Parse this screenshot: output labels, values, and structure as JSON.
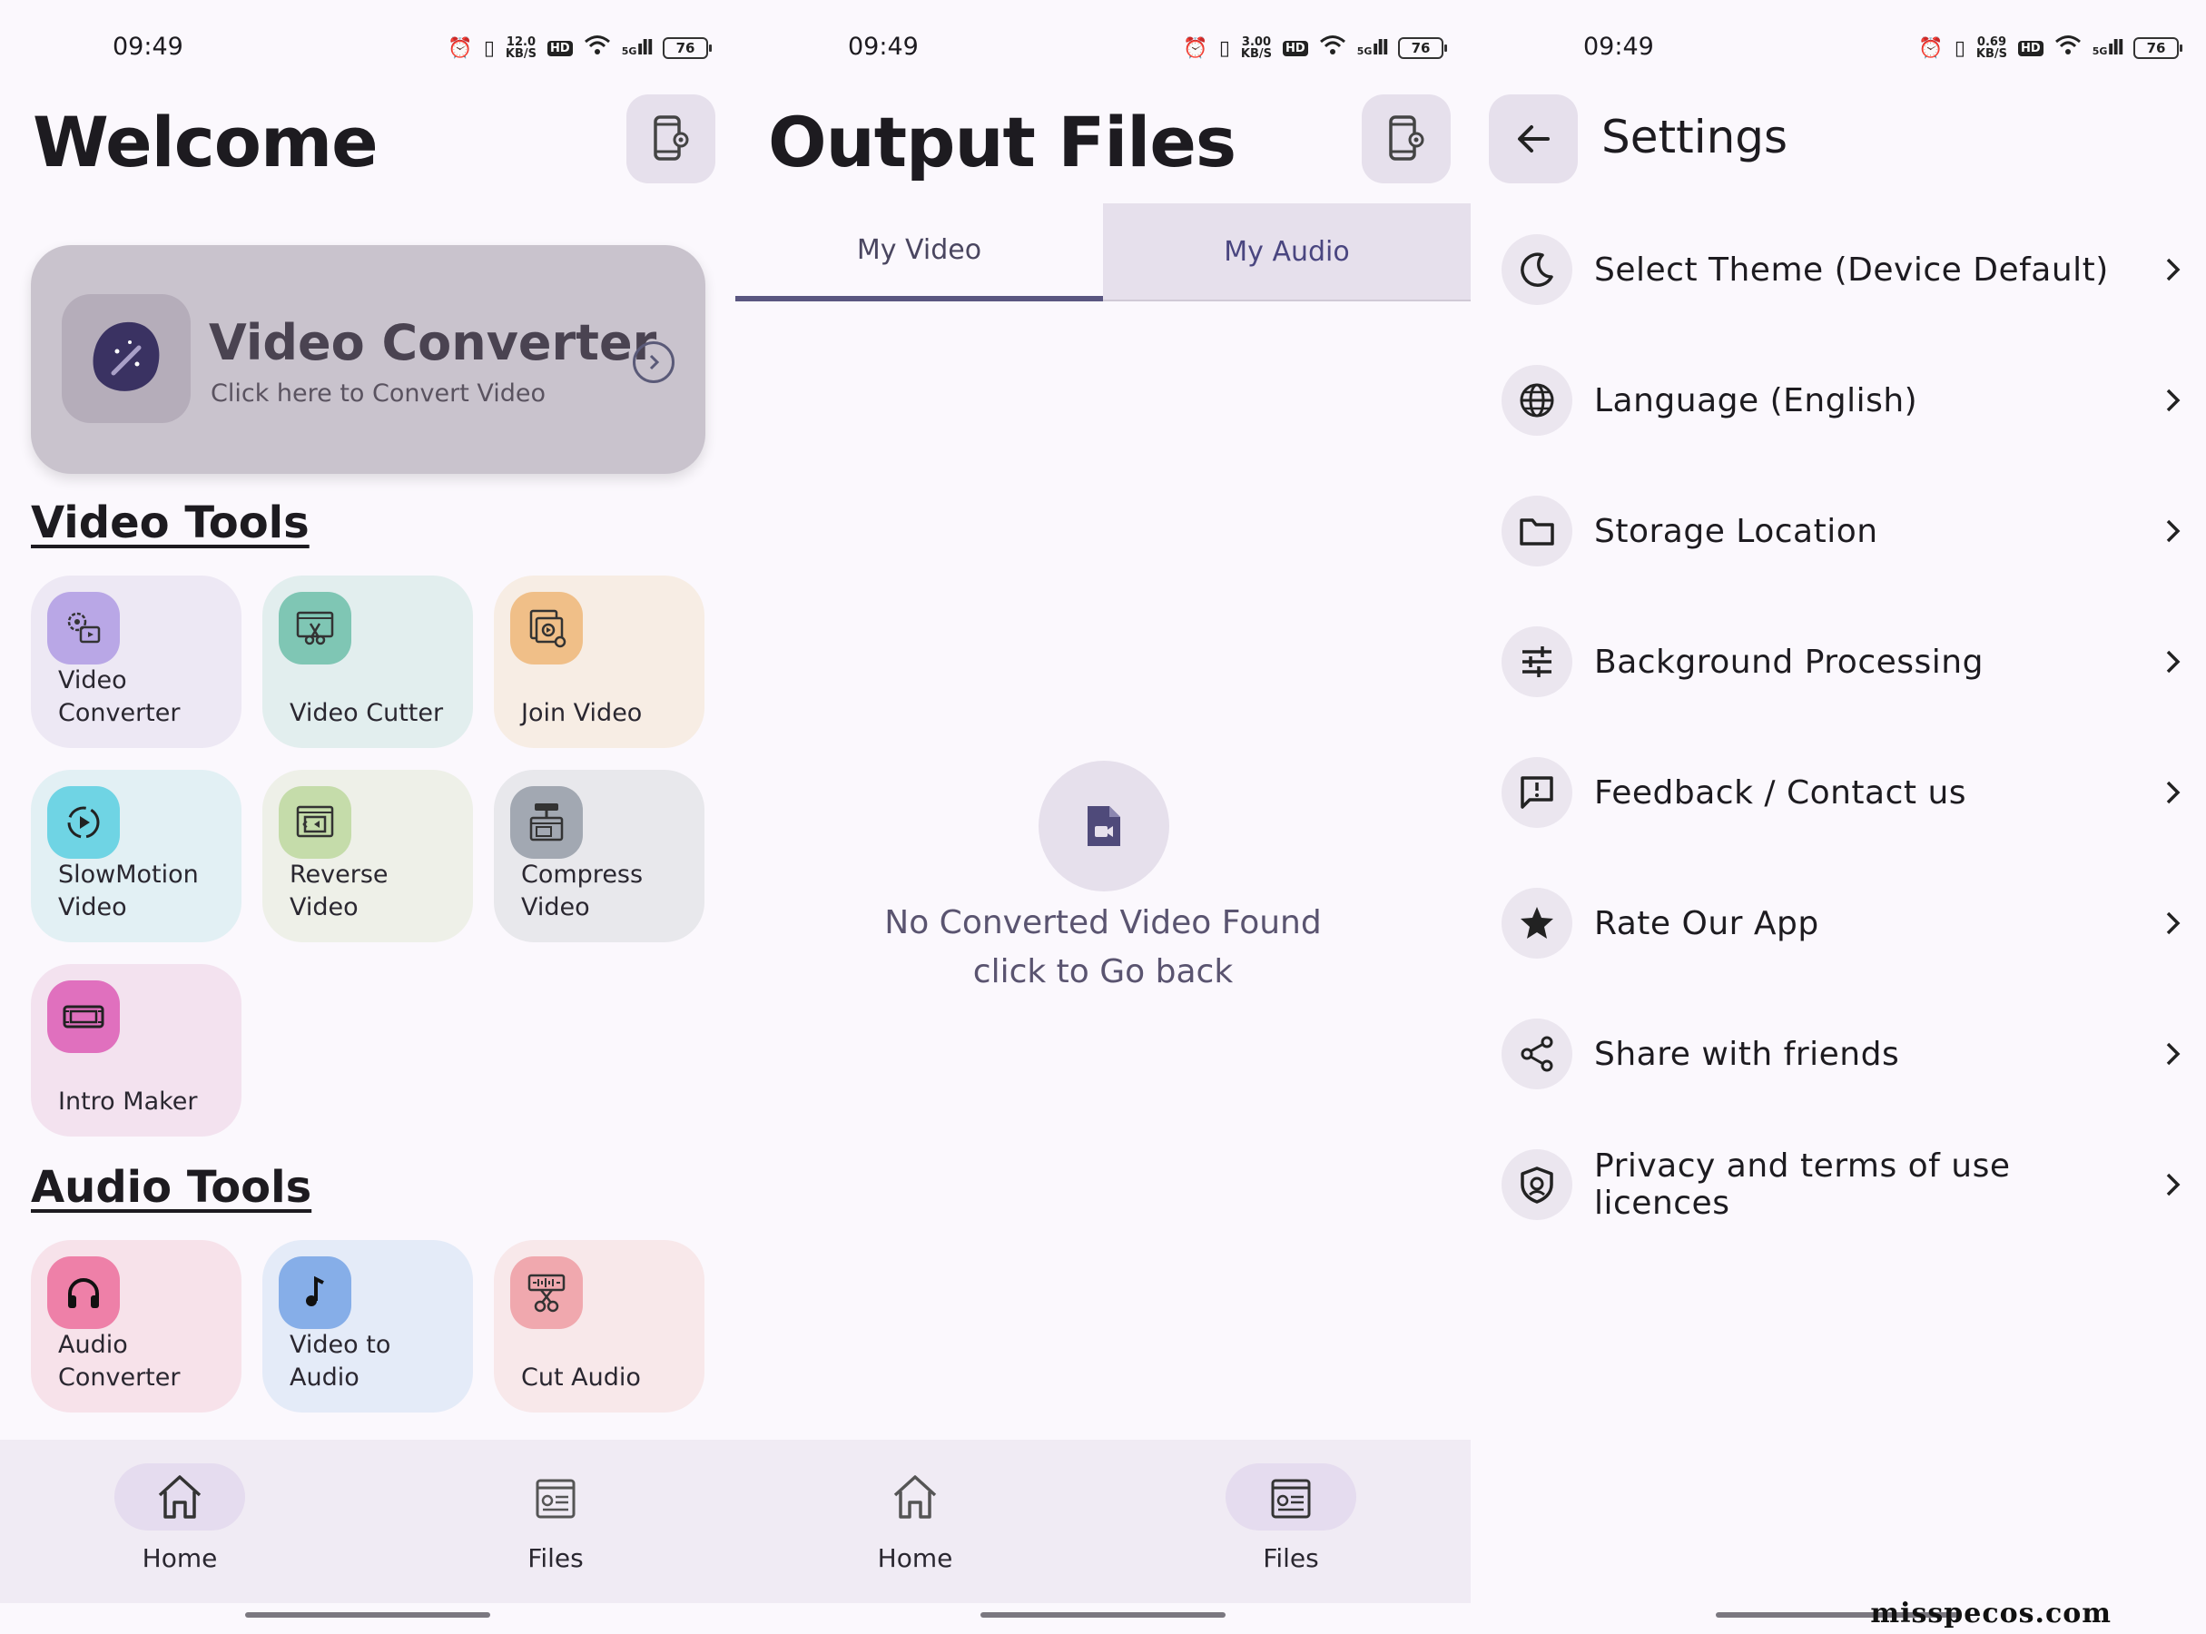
{
  "status": {
    "time": "09:49",
    "speeds": [
      "12.0\nKB/S",
      "3.00\nKB/S",
      "0.69\nKB/S"
    ],
    "battery": "76",
    "hd": "HD",
    "net": "5G"
  },
  "home": {
    "title": "Welcome",
    "hero": {
      "title": "Video Converter",
      "subtitle": "Click here to Convert Video"
    },
    "video_tools_title": "Video Tools",
    "video_tools": [
      {
        "label": "Video\nConverter",
        "bg": "#ede8f4",
        "icon_bg": "#b9a7e6"
      },
      {
        "label": "Video Cutter",
        "bg": "#e2eeee",
        "icon_bg": "#7fc6b4"
      },
      {
        "label": "Join Video",
        "bg": "#f7ede4",
        "icon_bg": "#f0bf88"
      },
      {
        "label": "SlowMotion\nVideo",
        "bg": "#e2f0f4",
        "icon_bg": "#6fd4e4"
      },
      {
        "label": "Reverse\nVideo",
        "bg": "#eef0e8",
        "icon_bg": "#c5dcaa"
      },
      {
        "label": "Compress\nVideo",
        "bg": "#e8e8ec",
        "icon_bg": "#a2a8b2"
      },
      {
        "label": "Intro Maker",
        "bg": "#f3e2ef",
        "icon_bg": "#e070be"
      }
    ],
    "audio_tools_title": "Audio Tools",
    "audio_tools": [
      {
        "label": "Audio\nConverter",
        "bg": "#f7e2ea",
        "icon_bg": "#ee80a8"
      },
      {
        "label": "Video to\nAudio",
        "bg": "#e4ebf8",
        "icon_bg": "#86aee8"
      },
      {
        "label": "Cut Audio",
        "bg": "#f8e8ea",
        "icon_bg": "#f0a8ae"
      }
    ]
  },
  "nav": {
    "home": "Home",
    "files": "Files"
  },
  "files": {
    "title": "Output Files",
    "tabs": [
      "My Video",
      "My Audio"
    ],
    "empty_line1": "No Converted Video Found",
    "empty_line2": "click to Go back"
  },
  "settings": {
    "title": "Settings",
    "items": [
      {
        "label": "Select Theme (Device Default)",
        "icon": "moon-icon"
      },
      {
        "label": "Language (English)",
        "icon": "globe-icon"
      },
      {
        "label": "Storage Location",
        "icon": "folder-icon"
      },
      {
        "label": "Background Processing",
        "icon": "sliders-icon"
      },
      {
        "label": "Feedback / Contact us",
        "icon": "feedback-icon"
      },
      {
        "label": "Rate Our App",
        "icon": "star-icon"
      },
      {
        "label": "Share with friends",
        "icon": "share-icon"
      },
      {
        "label": "Privacy and terms of use licences",
        "icon": "shield-icon"
      }
    ]
  },
  "watermark": "misspecos.com"
}
